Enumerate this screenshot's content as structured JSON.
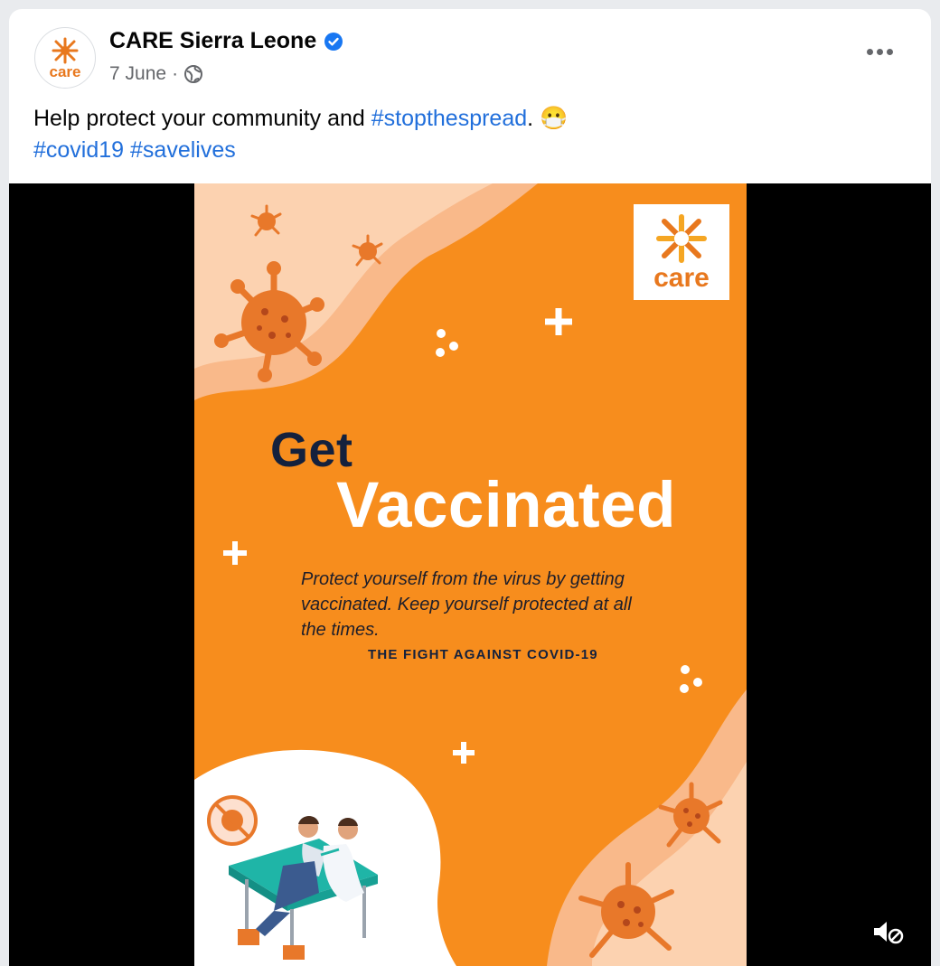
{
  "post": {
    "page_name": "CARE Sierra Leone",
    "date": "7 June",
    "separator": "·",
    "text_plain": "Help protect your community and ",
    "hashtag_1": "#stopthespread",
    "after_hashtag": ".",
    "emoji": "😷",
    "hashtag_2": "#covid19",
    "hashtag_3": "#savelives",
    "avatar_word": "care"
  },
  "poster": {
    "logo_word": "care",
    "headline_1": "Get",
    "headline_2": "Vaccinated",
    "body_line_1": "Protect yourself from the virus by getting",
    "body_line_2": "vaccinated. Keep yourself protected at all",
    "body_line_3": "the times.",
    "tagline": "THE FIGHT AGAINST COVID-19"
  },
  "icons": {
    "verified": "verified-badge-icon",
    "audience": "globe-icon",
    "more": "more-options-icon",
    "sound": "sound-muted-icon"
  },
  "colors": {
    "brand_orange": "#f78d1d",
    "link_blue": "#216fdb",
    "verified_blue": "#1877f2",
    "navy": "#14213d"
  }
}
